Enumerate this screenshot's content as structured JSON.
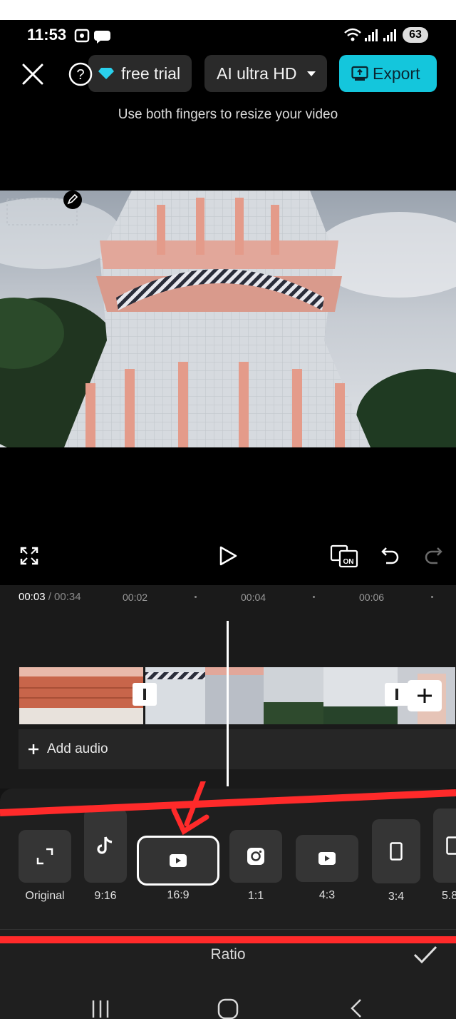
{
  "status_bar": {
    "time": "11:53",
    "battery": "63"
  },
  "toolbar": {
    "free_trial_label": "free trial",
    "quality_label": "AI ultra HD",
    "export_label": "Export"
  },
  "hint": "Use both fingers to resize your video",
  "timeline": {
    "current_time": "00:03",
    "total_time": "/ 00:34",
    "ticks": [
      "00:02",
      "00:04",
      "00:06"
    ],
    "add_audio_label": "Add audio"
  },
  "ratios": [
    {
      "label": "Original",
      "icon": "expand-icon"
    },
    {
      "label": "9:16",
      "icon": "tiktok-icon"
    },
    {
      "label": "16:9",
      "icon": "youtube-icon",
      "selected": true
    },
    {
      "label": "1:1",
      "icon": "instagram-icon"
    },
    {
      "label": "4:3",
      "icon": "youtube-icon"
    },
    {
      "label": "3:4",
      "icon": "portrait-rect-icon"
    },
    {
      "label": "5.8",
      "icon": "portrait-rect-icon"
    }
  ],
  "panel_title": "Ratio",
  "colors": {
    "accent": "#14c6dc",
    "annotation": "#ff2a2a",
    "background": "#000000"
  }
}
